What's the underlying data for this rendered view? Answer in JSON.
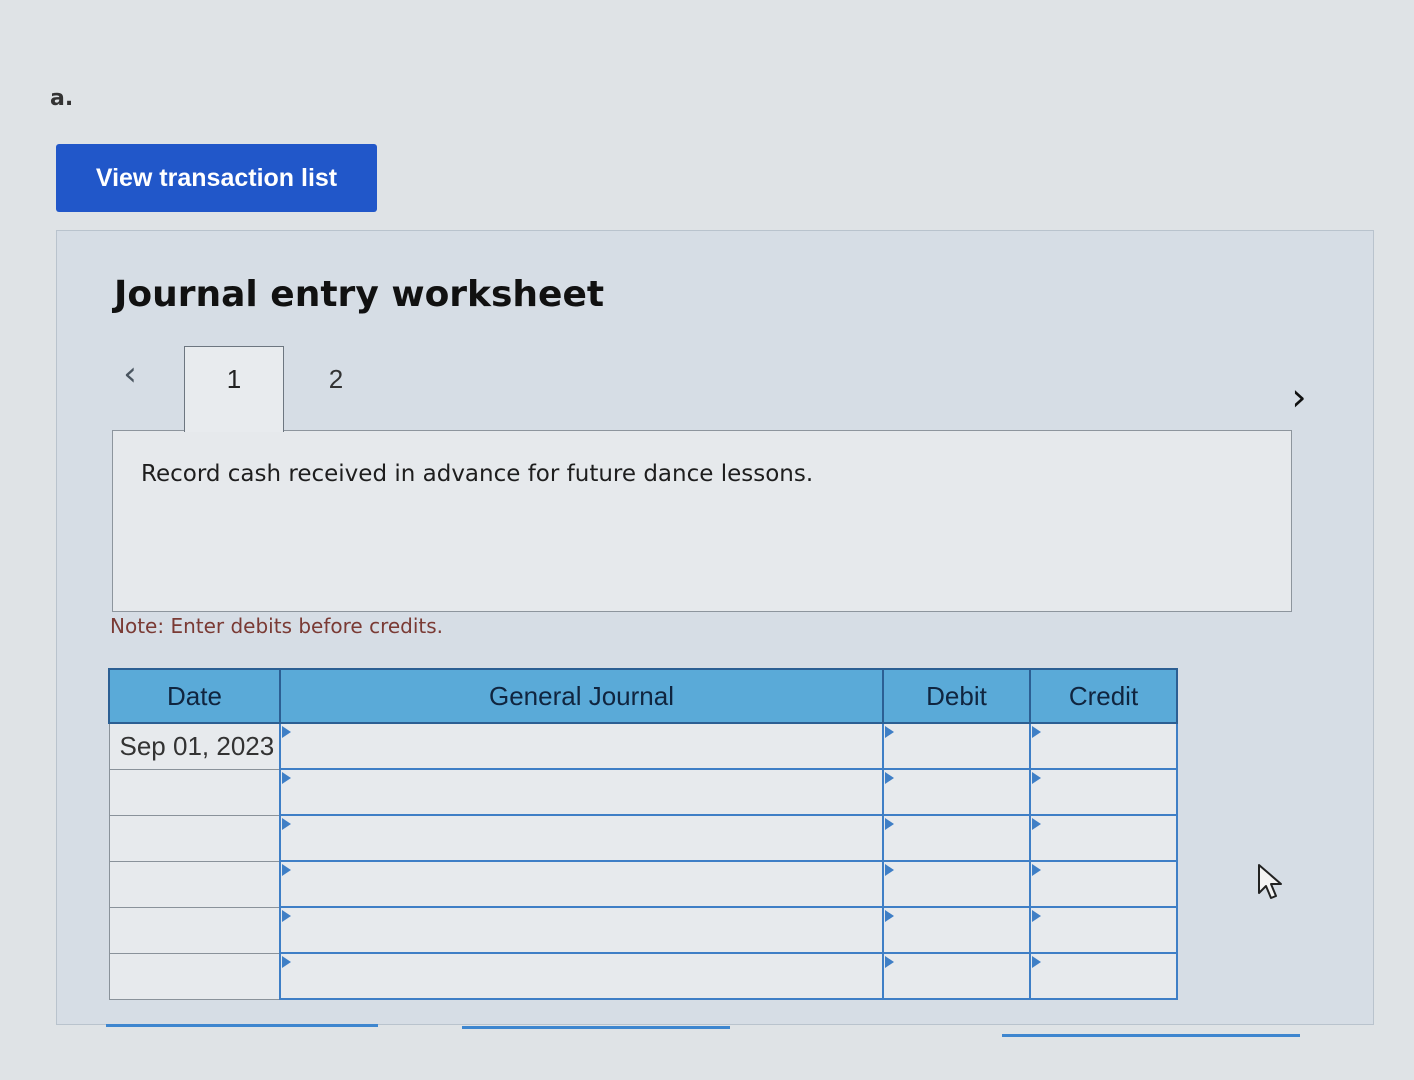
{
  "part_label": "a.",
  "view_button_label": "View transaction list",
  "worksheet": {
    "title": "Journal entry worksheet",
    "prev_symbol": "‹",
    "next_symbol": "›",
    "tabs": [
      {
        "label": "1",
        "active": true
      },
      {
        "label": "2",
        "active": false
      }
    ],
    "description": "Record cash received in advance for future dance lessons.",
    "note": "Note: Enter debits before credits."
  },
  "journal": {
    "headers": {
      "date": "Date",
      "general_journal": "General Journal",
      "debit": "Debit",
      "credit": "Credit"
    },
    "rows": [
      {
        "date": "Sep 01, 2023",
        "account": "",
        "debit": "",
        "credit": ""
      },
      {
        "date": "",
        "account": "",
        "debit": "",
        "credit": ""
      },
      {
        "date": "",
        "account": "",
        "debit": "",
        "credit": ""
      },
      {
        "date": "",
        "account": "",
        "debit": "",
        "credit": ""
      },
      {
        "date": "",
        "account": "",
        "debit": "",
        "credit": ""
      },
      {
        "date": "",
        "account": "",
        "debit": "",
        "credit": ""
      }
    ]
  },
  "colors": {
    "button": "#2157c9",
    "header": "#5aaad8",
    "cell_border": "#3f7fc6"
  },
  "icons": {
    "cursor": "mouse-pointer-icon"
  }
}
